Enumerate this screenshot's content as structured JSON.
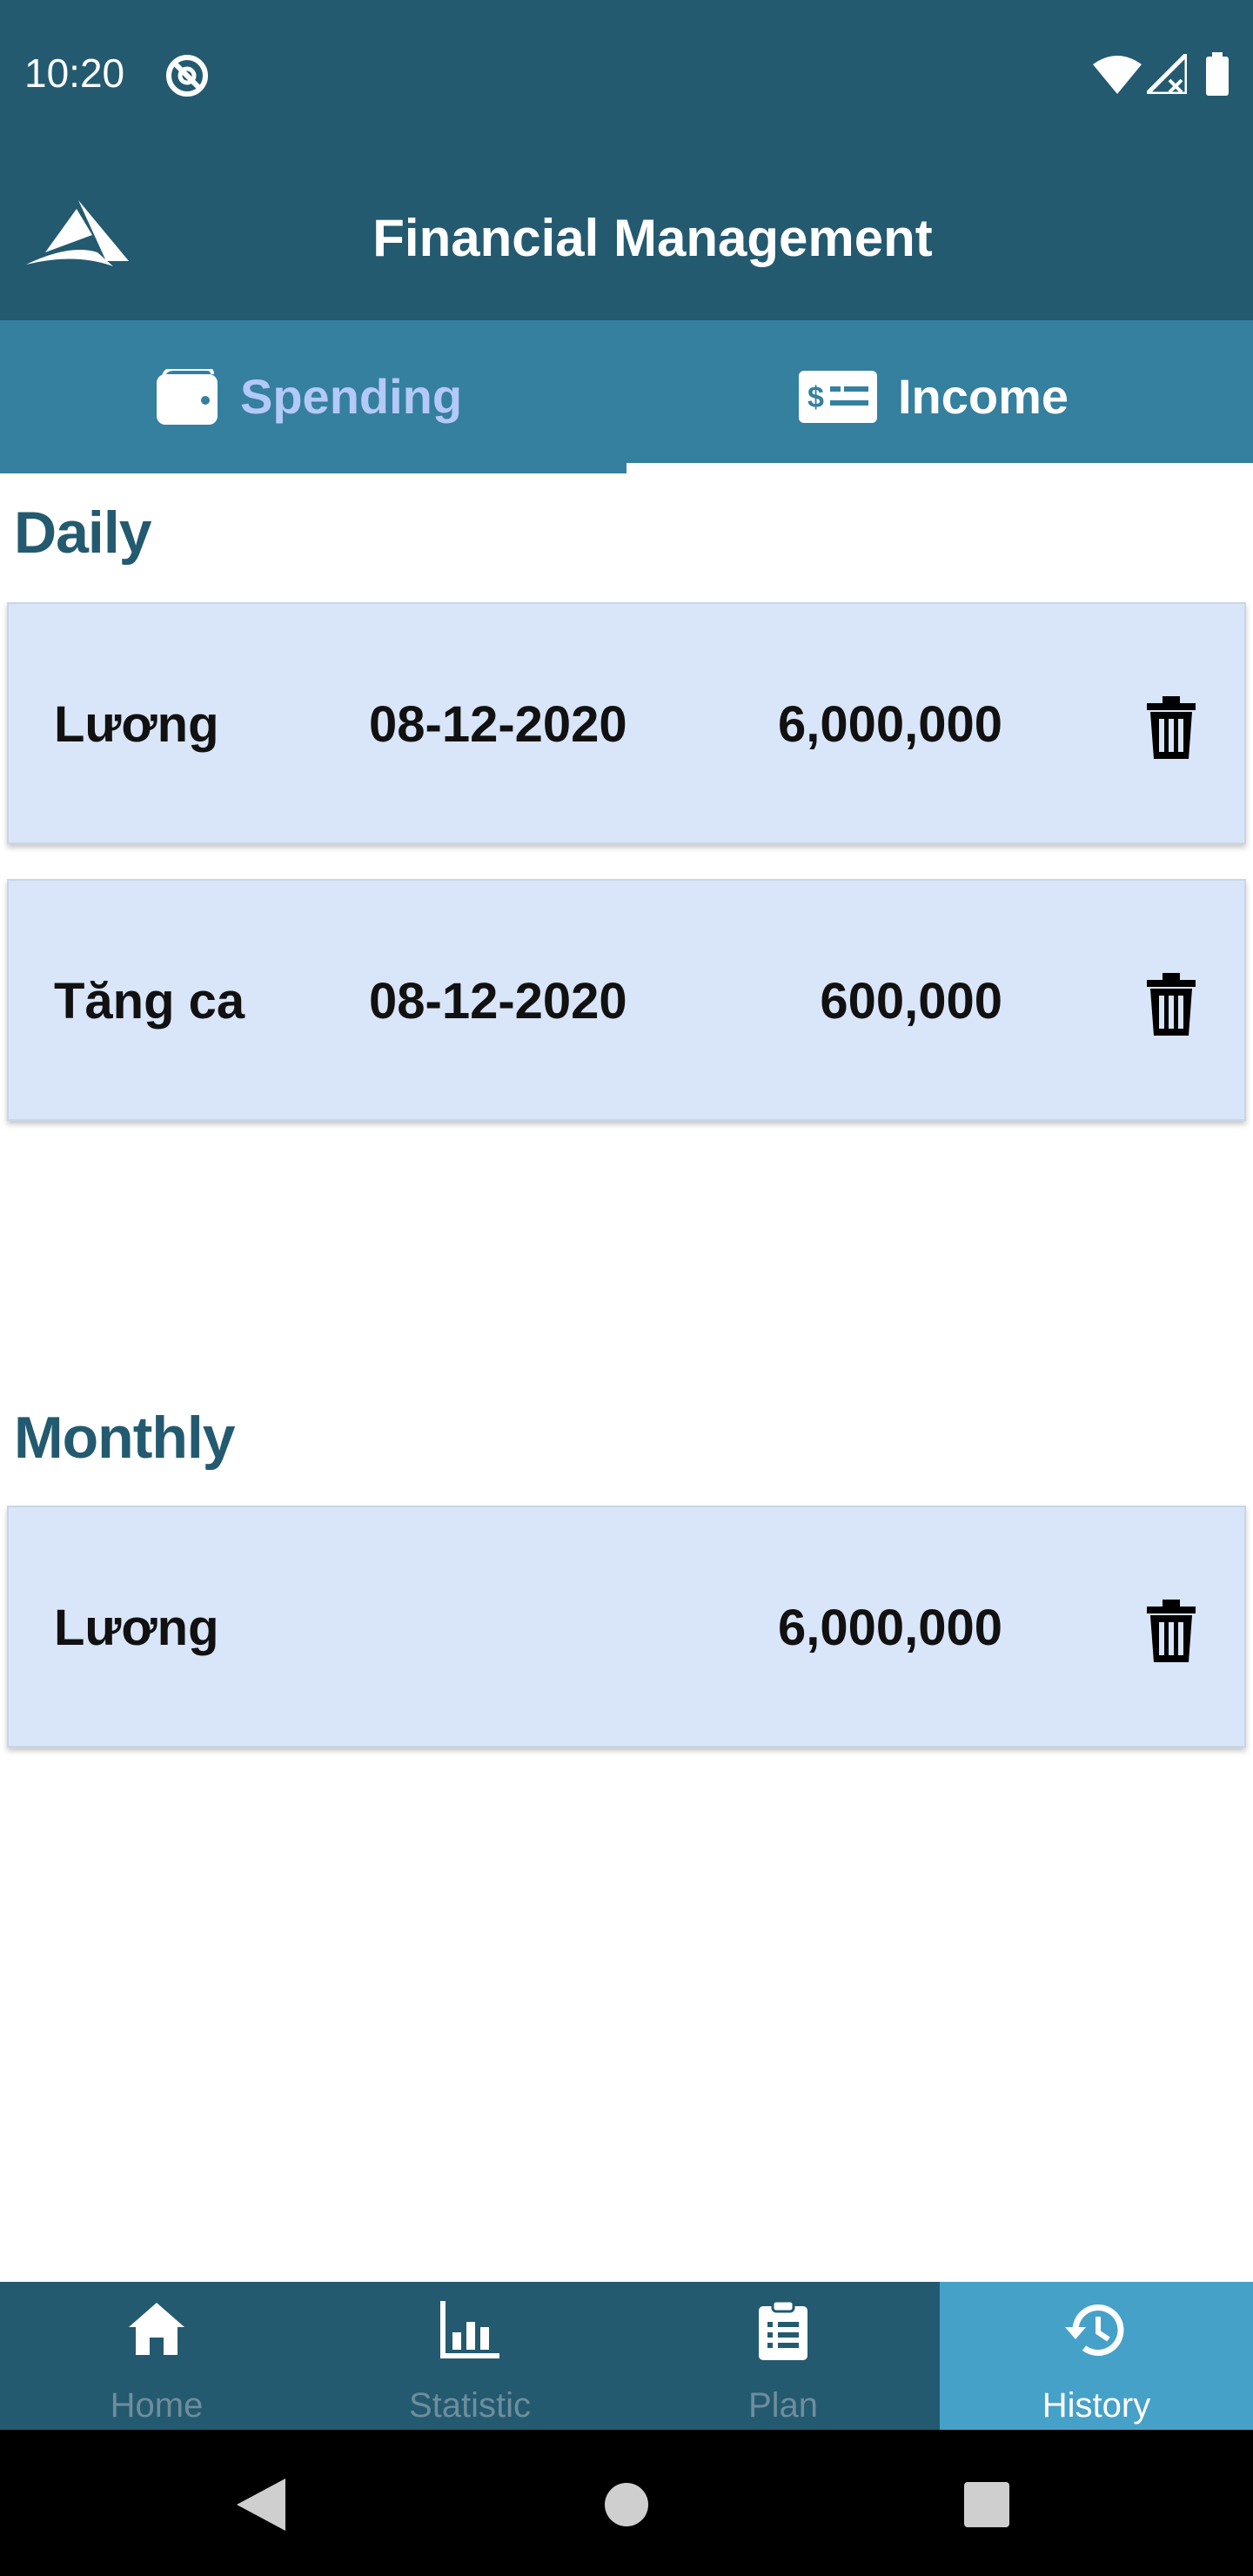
{
  "status_bar": {
    "time": "10:20",
    "icons": [
      "do-not-disturb-icon",
      "wifi-icon",
      "signal-icon",
      "battery-icon"
    ]
  },
  "app_bar": {
    "title": "Financial Management",
    "logo_icon": "app-logo-icon"
  },
  "tabs": [
    {
      "label": "Spending",
      "icon": "wallet-icon",
      "active": false,
      "color": "#b3c9f7"
    },
    {
      "label": "Income",
      "icon": "money-card-icon",
      "active": true,
      "color": "#ffffff"
    }
  ],
  "daily": {
    "title": "Daily",
    "items": [
      {
        "name": "Lương",
        "date": "08-12-2020",
        "amount": "6,000,000"
      },
      {
        "name": "Tăng ca",
        "date": "08-12-2020",
        "amount": "600,000"
      }
    ]
  },
  "monthly": {
    "title": "Monthly",
    "items": [
      {
        "name": "Lương",
        "amount": "6,000,000"
      }
    ]
  },
  "bottom_nav": [
    {
      "label": "Home",
      "icon": "home-icon",
      "active": false
    },
    {
      "label": "Statistic",
      "icon": "bar-chart-icon",
      "active": false
    },
    {
      "label": "Plan",
      "icon": "clipboard-list-icon",
      "active": false
    },
    {
      "label": "History",
      "icon": "history-icon",
      "active": true
    }
  ],
  "colors": {
    "primary": "#235a70",
    "tab_bar": "#357f9f",
    "active_nav": "#46a1c9",
    "card_bg": "#d9e5f8"
  }
}
